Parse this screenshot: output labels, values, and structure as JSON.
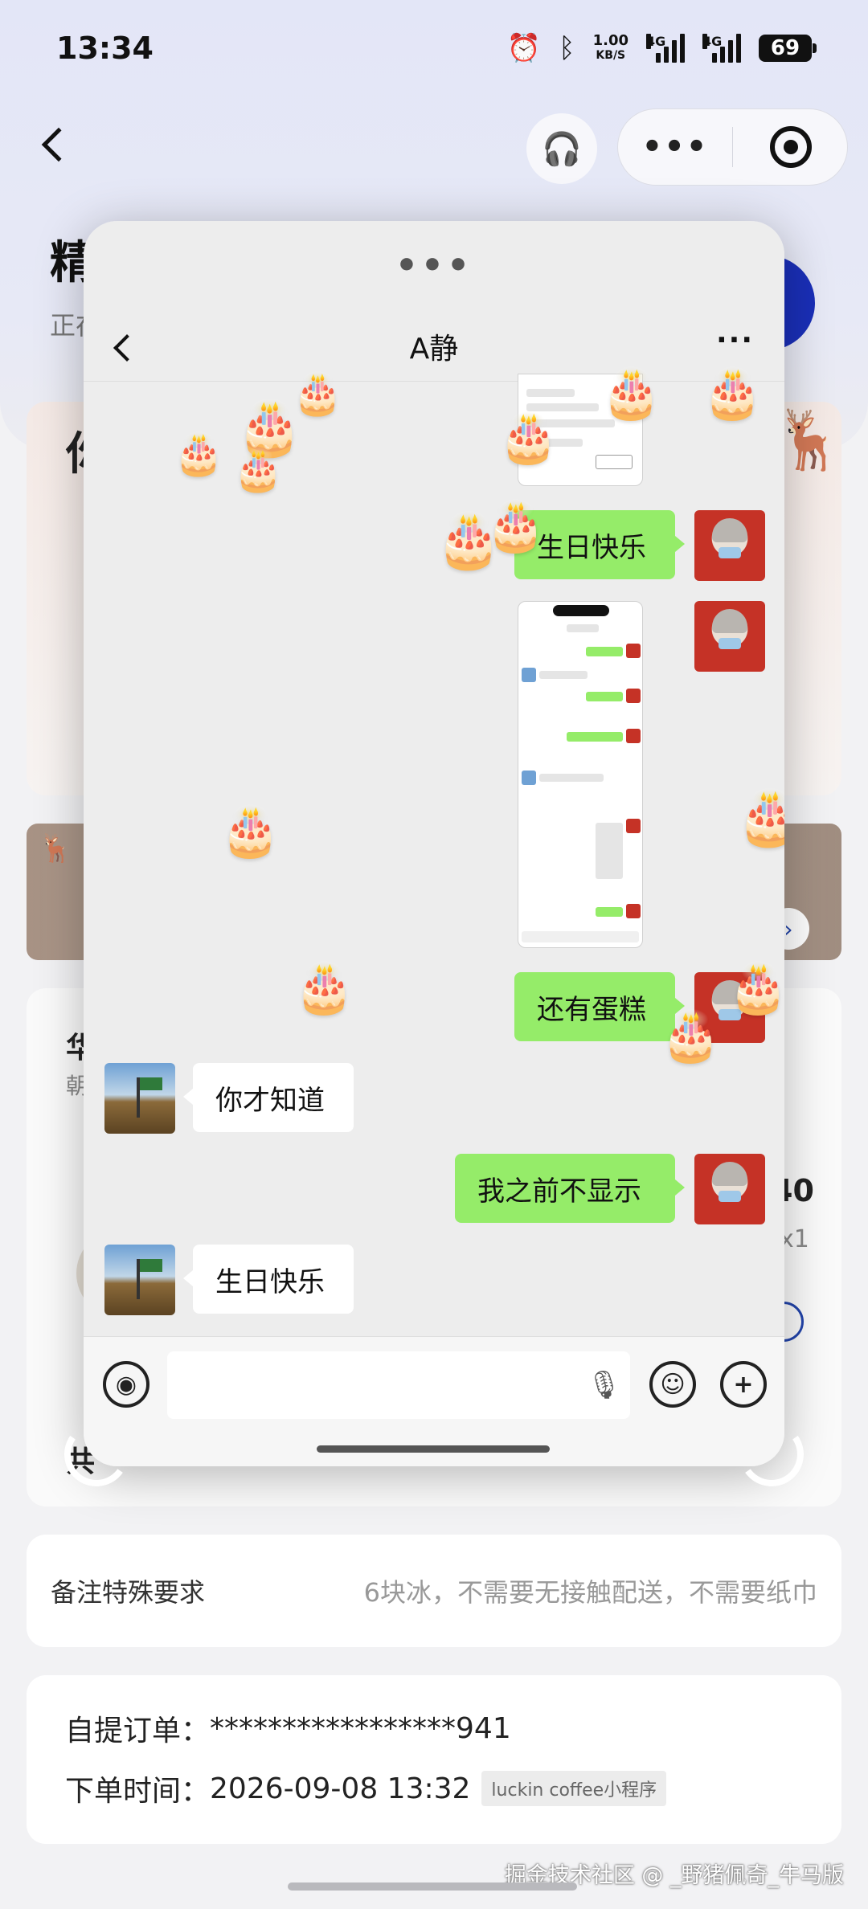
{
  "status_bar": {
    "time": "13:34",
    "net_speed_value": "1.00",
    "net_speed_unit": "KB/S",
    "sig1_label": "4G",
    "sig2_label": "4G",
    "battery": "69"
  },
  "background_page": {
    "title_partial": "精",
    "subtitle_partial": "正在",
    "card1_partial": "你",
    "banner_logo": "luckin",
    "card2_title_partial": "华",
    "card2_sub_partial": "朝",
    "card2_price_partial": "40",
    "card2_qty": "x1",
    "card2_bottom_partial": "共",
    "note_label": "备注特殊要求",
    "note_value": "6块冰，不需要无接触配送，不需要纸巾",
    "order_label": "自提订单：",
    "order_value": "*****************941",
    "time_label": "下单时间：",
    "time_value": "2026-09-08 13:32",
    "source_tag": "luckin coffee小程序"
  },
  "chat": {
    "title": "A静",
    "grip": "•••",
    "more": "···",
    "messages": [
      {
        "from": "me",
        "type": "image"
      },
      {
        "from": "me",
        "type": "text",
        "text": "生日快乐"
      },
      {
        "from": "me",
        "type": "image"
      },
      {
        "from": "me",
        "type": "text",
        "text": "还有蛋糕"
      },
      {
        "from": "her",
        "type": "text",
        "text": "你才知道"
      },
      {
        "from": "me",
        "type": "text",
        "text": "我之前不显示"
      },
      {
        "from": "her",
        "type": "text",
        "text": "生日快乐"
      }
    ],
    "effect_emoji": "🎂",
    "input_placeholder": ""
  },
  "watermark": "掘金技术社区 @ _野猪佩奇_牛马版",
  "icons": {
    "voice": "voice-icon",
    "emoji": "emoji-icon",
    "plus": "plus-icon",
    "mic": "mic-icon"
  }
}
